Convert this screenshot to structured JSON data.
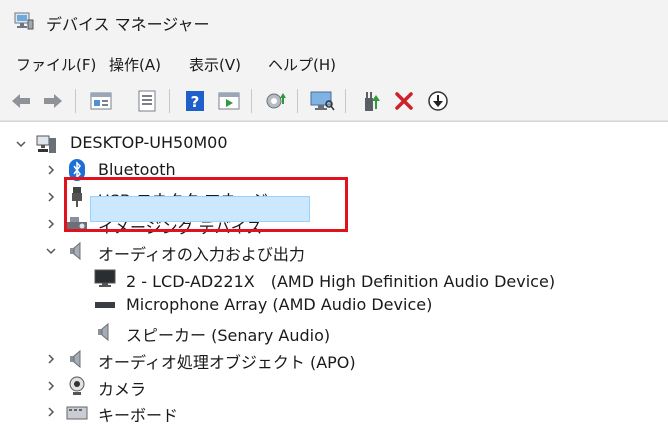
{
  "window": {
    "title": "デバイス マネージャー"
  },
  "menu": {
    "items": [
      "ファイル(F)",
      "操作(A)",
      "表示(V)",
      "ヘルプ(H)"
    ]
  },
  "toolbar": {
    "buttons": [
      "back-icon",
      "forward-icon",
      "properties-icon",
      "show-hidden-icon",
      "help-icon",
      "details-view-icon",
      "update-driver-icon",
      "scan-hardware-icon",
      "enable-device-icon",
      "uninstall-icon",
      "disable-icon"
    ]
  },
  "tree": {
    "root": "DESKTOP-UH50M00",
    "categories": [
      {
        "label": "Bluetooth",
        "icon": "bluetooth-icon",
        "expanded": false
      },
      {
        "label": "USB コネクタ マネージャー",
        "icon": "usb-icon",
        "expanded": false
      },
      {
        "label": "イメージング デバイス",
        "icon": "camera-device-icon",
        "expanded": false
      },
      {
        "label": "オーディオの入力および出力",
        "icon": "speaker-icon",
        "expanded": true
      },
      {
        "label": "オーディオ処理オブジェクト (APO)",
        "icon": "speaker-icon",
        "expanded": false
      },
      {
        "label": "カメラ",
        "icon": "webcam-icon",
        "expanded": false
      },
      {
        "label": "キーボード",
        "icon": "keyboard-icon",
        "expanded": false
      }
    ],
    "audio_children": [
      {
        "label": "2 - LCD-AD221X　(AMD High Definition Audio Device)",
        "icon": "monitor-icon"
      },
      {
        "label": "Microphone Array (AMD Audio Device)",
        "icon": "microphone-icon"
      },
      {
        "label": "スピーカー (Senary Audio)",
        "icon": "speaker-icon",
        "selected": true
      }
    ]
  },
  "colors": {
    "selection": "#cce8ff",
    "highlight_box": "#e0121e",
    "chrome": "#f3f3f3"
  }
}
